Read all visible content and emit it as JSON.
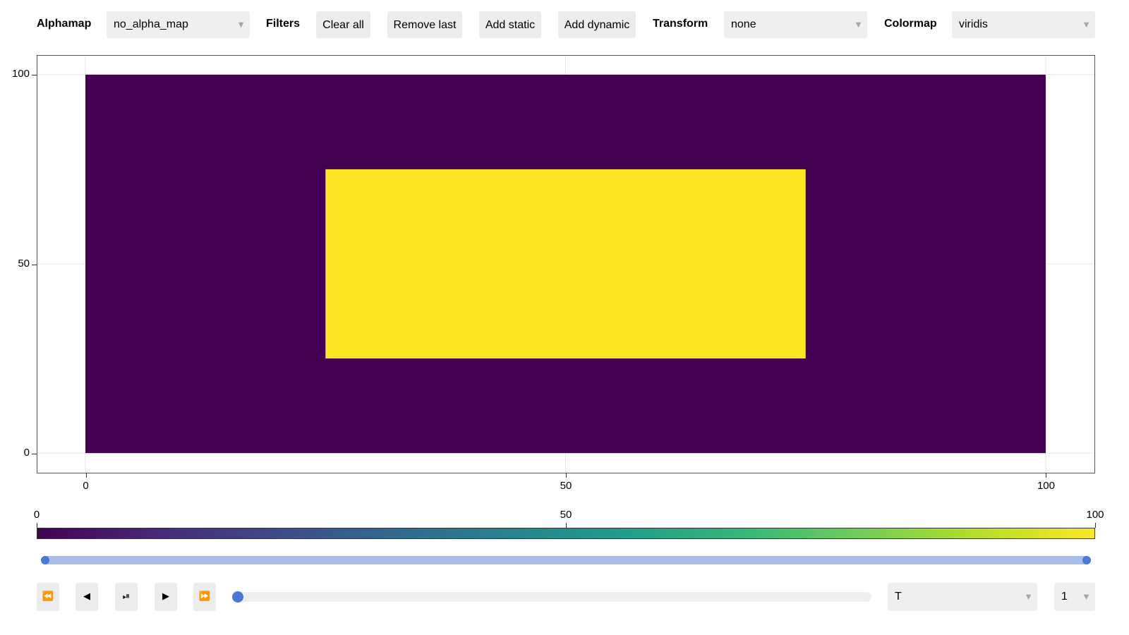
{
  "toolbar": {
    "alphamap_label": "Alphamap",
    "alphamap_value": "no_alpha_map",
    "filters_label": "Filters",
    "clear_all": "Clear all",
    "remove_last": "Remove last",
    "add_static": "Add static",
    "add_dynamic": "Add dynamic",
    "transform_label": "Transform",
    "transform_value": "none",
    "colormap_label": "Colormap",
    "colormap_value": "viridis",
    "dropdown_icon": "triangle-down"
  },
  "chart_data": {
    "type": "heatmap",
    "title": "",
    "xlabel": "",
    "ylabel": "",
    "xlim": [
      -5,
      105
    ],
    "ylim": [
      -5,
      105
    ],
    "grid": true,
    "x_ticks": [
      "0",
      "50",
      "100"
    ],
    "y_ticks": [
      "0",
      "50",
      "100"
    ],
    "colormap": "viridis",
    "background_value": 0,
    "regions": [
      {
        "x0": 0,
        "x1": 100,
        "y0": 0,
        "y1": 100,
        "value": 0
      },
      {
        "x0": 25,
        "x1": 75,
        "y0": 25,
        "y1": 75,
        "value": 100
      }
    ],
    "colorbar": {
      "range": [
        0,
        100
      ],
      "ticks": [
        "0",
        "50",
        "100"
      ],
      "stops": [
        "#440154",
        "#482878",
        "#3e4989",
        "#31688e",
        "#26828e",
        "#1f9e89",
        "#35b779",
        "#6ece58",
        "#b5de2b",
        "#fde725"
      ]
    }
  },
  "range_slider": {
    "low": 0,
    "high": 1
  },
  "player": {
    "rewind_icon": "⏪",
    "step_back_icon": "◀",
    "play_pause_icon": "⏯",
    "play_icon": "▶",
    "fast_forward_icon": "⏩",
    "time_position": 0,
    "dimension_value": "T",
    "index_value": "1"
  }
}
